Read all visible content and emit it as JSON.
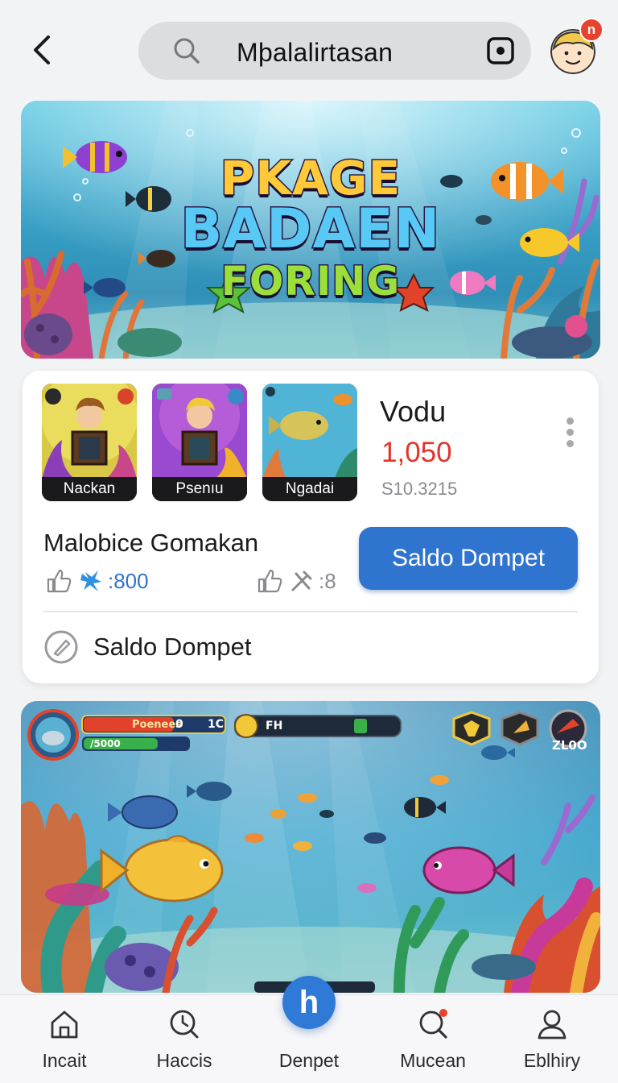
{
  "header": {
    "search_text": "Mþalalirtasan",
    "notification_count": "n"
  },
  "hero": {
    "line1": "PKAGE",
    "line2": "BADAEN",
    "line3": "FORING"
  },
  "info_card": {
    "thumbnails": [
      {
        "label": "Nackan"
      },
      {
        "label": "Psenıu"
      },
      {
        "label": "Ngadai"
      }
    ],
    "name": "Vodu",
    "amount": "1,050",
    "sub_value": "S10.3215",
    "game_title": "Malobice Gomakan",
    "stat_left": ":800",
    "stat_right": ":8",
    "primary_button": "Saldo Dompet",
    "bottom_link": "Saldo Dompet"
  },
  "game_preview": {
    "hud_bar_label": "Poenees",
    "hud_bar_value1": "0",
    "hud_bar_value2": "1C",
    "hud_xp": "/5000",
    "hud_center": "FH",
    "hud_score": "ZL0O"
  },
  "nav": {
    "items": [
      {
        "label": "Incait",
        "icon": "home-icon"
      },
      {
        "label": "Haccis",
        "icon": "history-icon"
      },
      {
        "label": "Denpet",
        "icon": "wallet-icon"
      },
      {
        "label": "Mucean",
        "icon": "search-notify-icon"
      },
      {
        "label": "Eblhiry",
        "icon": "profile-icon"
      }
    ],
    "center_glyph": "h"
  },
  "colors": {
    "accent": "#2f74cf",
    "amount_red": "#e2352a",
    "stat_blue": "#2f74cf"
  }
}
